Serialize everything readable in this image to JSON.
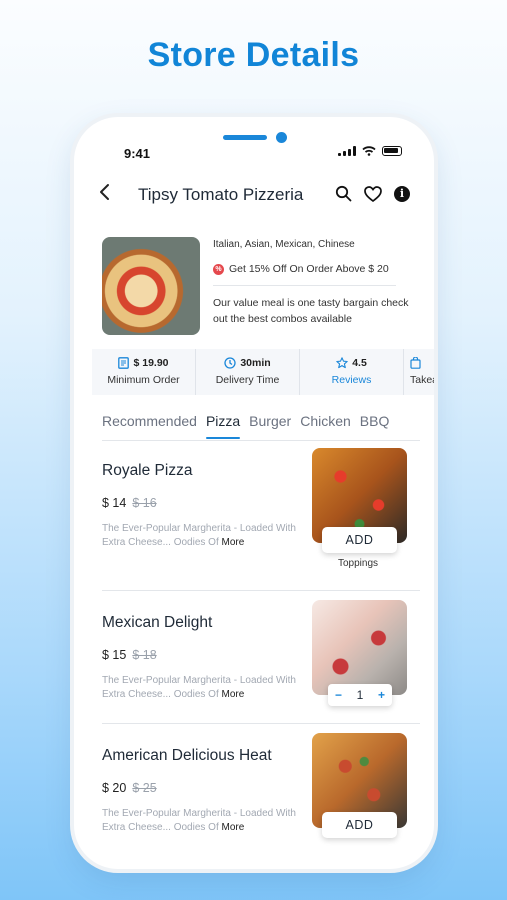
{
  "page_title": "Store Details",
  "status_bar": {
    "time": "9:41"
  },
  "header": {
    "back_icon": "chevron-left-icon",
    "store_name": "Tipsy Tomato Pizzeria"
  },
  "store": {
    "cuisines": "Italian, Asian, Mexican, Chinese",
    "offer": "Get 15% Off On Order Above $ 20",
    "description": "Our value meal is one tasty bargain check out the best combos available"
  },
  "stats": [
    {
      "value": "$ 19.90",
      "label": "Minimum Order",
      "icon": "menu-icon"
    },
    {
      "value": "30min",
      "label": "Delivery Time",
      "icon": "clock-icon"
    },
    {
      "value": "4.5",
      "label": "Reviews",
      "icon": "star-icon"
    },
    {
      "value": "",
      "label": "Takea",
      "icon": "bag-icon"
    }
  ],
  "tabs": [
    "Recommended",
    "Pizza",
    "Burger",
    "Chicken",
    "BBQ"
  ],
  "active_tab": "Pizza",
  "items": [
    {
      "name": "Royale Pizza",
      "price": "$ 14",
      "old_price": "$ 16",
      "desc": "The Ever-Popular Margherita - Loaded With Extra Cheese... Oodies Of",
      "more": "More",
      "button": "ADD",
      "extra": "Toppings"
    },
    {
      "name": "Mexican Delight",
      "price": "$ 15",
      "old_price": "$ 18",
      "desc": "The Ever-Popular Margherita - Loaded With Extra Cheese... Oodies Of",
      "more": "More",
      "quantity": "1",
      "minus": "−",
      "plus": "+"
    },
    {
      "name": "American Delicious Heat",
      "price": "$ 20",
      "old_price": "$ 25",
      "desc": "The Ever-Popular Margherita - Loaded With Extra Cheese... Oodies Of",
      "more": "More",
      "button": "ADD"
    }
  ],
  "colors": {
    "accent": "#1a87d9",
    "title": "#1185d7",
    "offer": "#e5484d"
  }
}
